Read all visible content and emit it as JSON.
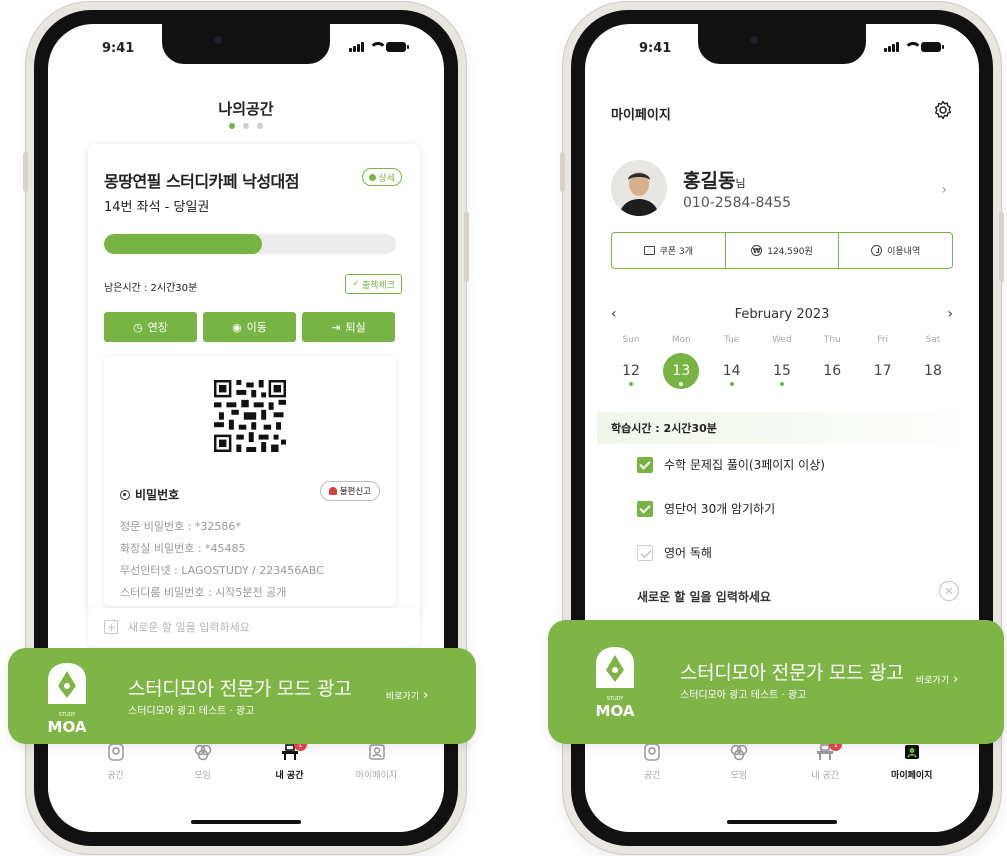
{
  "status": {
    "time_left": "9:41",
    "time_right": "9:41"
  },
  "left": {
    "title": "나의공간",
    "store_name": "몽땅연필 스터디카페 낙성대점",
    "detail_label": "상세",
    "seat_info": "14번 좌석 - 당일권",
    "progress": 0.54,
    "remaining": "남은시간 : 2시간30분",
    "checkout_label": "출첵체크",
    "actions": [
      "연장",
      "이동",
      "퇴실"
    ],
    "password_title": "비밀번호",
    "report_label": "불편신고",
    "passwords": [
      "정문 비밀번호 : *32586*",
      "화장실 비밀번호 : *45485",
      "무선인터넷 : LAGOSTUDY / 223456ABC",
      "스터디룸 비밀번호 : 시작5분전 공개"
    ],
    "todo_placeholder": "새로운 할 일을 입력하세요"
  },
  "right": {
    "title": "마이페이지",
    "user_name": "홍길동",
    "user_suffix": "님",
    "user_phone": "010-2584-8455",
    "stats": {
      "coupons": "쿠폰 3개",
      "points": "124,590원",
      "history": "이용내역"
    },
    "month": "February 2023",
    "weekdays": [
      "Sun",
      "Mon",
      "Tue",
      "Wed",
      "Thu",
      "Fri",
      "Sat"
    ],
    "dates": [
      "12",
      "13",
      "14",
      "15",
      "16",
      "17",
      "18"
    ],
    "date_dots": [
      true,
      true,
      true,
      true,
      false,
      false,
      false
    ],
    "selected_index": 1,
    "study_time": "학습시간 : 2시간30분",
    "todos": [
      {
        "text": "수학 문제집 풀이(3페이지 이상)",
        "done": true
      },
      {
        "text": "영단어 30개 암기하기",
        "done": true
      },
      {
        "text": "영어 독해",
        "done": false
      }
    ],
    "new_todo": "새로운 할 일을 입력하세요"
  },
  "ad": {
    "headline": "스터디모아 전문가 모드 광고",
    "sub": "스터디모아 광고 테스트 · 광고",
    "cta": "바로가기",
    "logo_text": "MOA",
    "logo_small": "STUDY"
  },
  "tabs": [
    "공간",
    "모임",
    "내 공간",
    "마이페이지"
  ],
  "tab_badge": "1",
  "colors": {
    "accent": "#78b443",
    "banner": "#7fb547",
    "badge": "#e5484d"
  }
}
